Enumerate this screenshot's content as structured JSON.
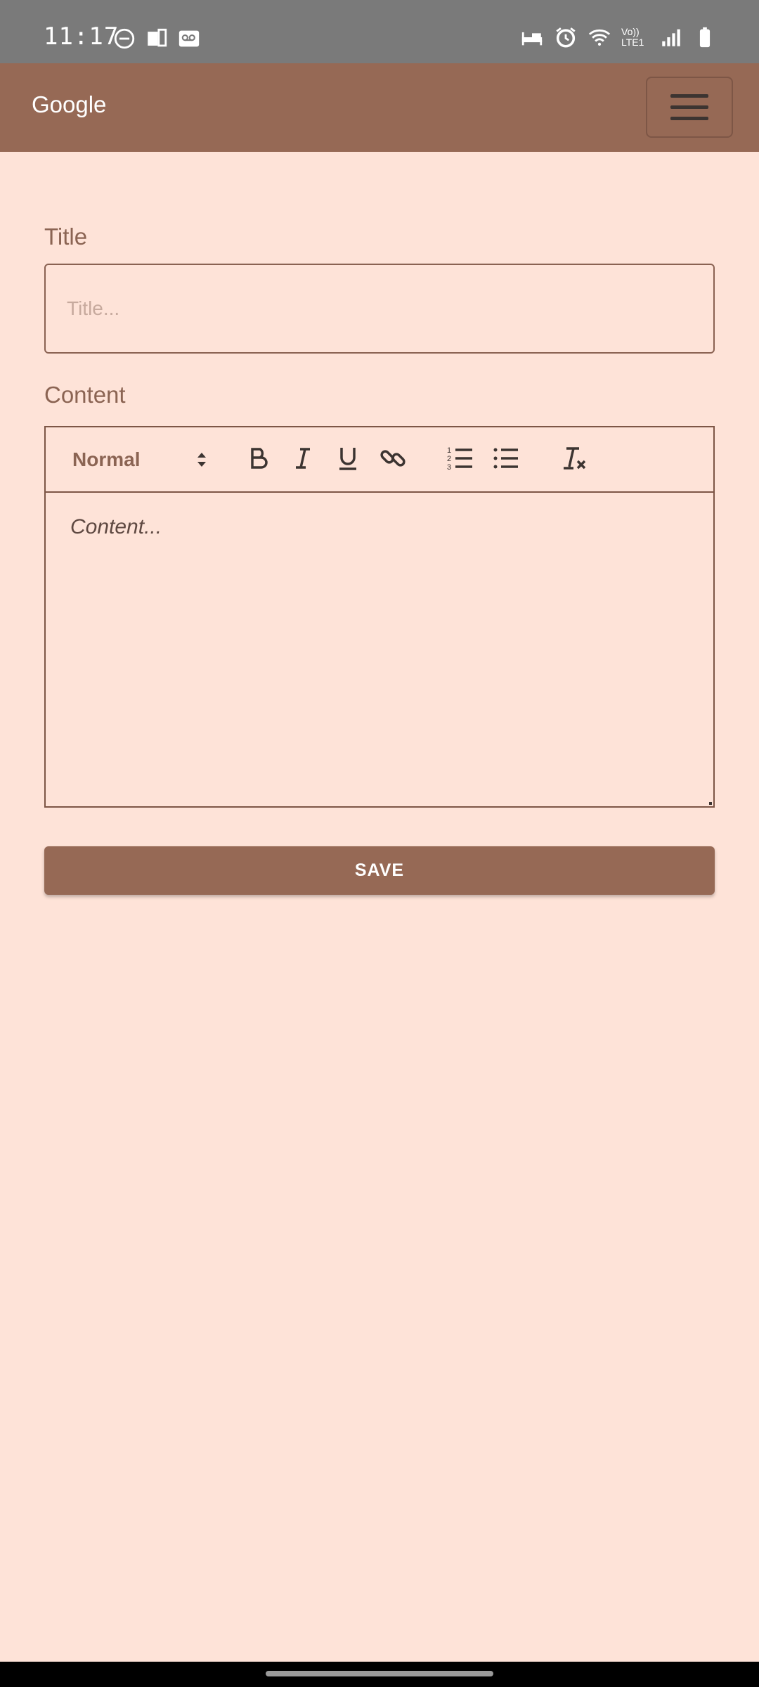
{
  "status_bar": {
    "time": "11:17",
    "left_icons": [
      "do-not-disturb-icon",
      "device-icon",
      "voicemail-icon"
    ],
    "right_icons": [
      "bed-icon",
      "alarm-icon",
      "wifi-icon",
      "volte-icon",
      "signal-icon",
      "battery-icon"
    ],
    "volte_text": "Vo)) LTE1"
  },
  "app_bar": {
    "brand": "Google",
    "menu_icon": "hamburger-menu-icon"
  },
  "form": {
    "title_label": "Title",
    "title_placeholder": "Title...",
    "title_value": "",
    "content_label": "Content",
    "content_placeholder": "Content...",
    "save_label": "SAVE"
  },
  "toolbar": {
    "format_value": "Normal",
    "buttons": [
      "bold-icon",
      "italic-icon",
      "underline-icon",
      "link-icon",
      "ordered-list-icon",
      "bullet-list-icon",
      "clear-format-icon"
    ]
  },
  "colors": {
    "background": "#fee3d8",
    "primary": "#966955",
    "status_bar": "#7a7a7a",
    "text_muted": "#8b6453"
  }
}
